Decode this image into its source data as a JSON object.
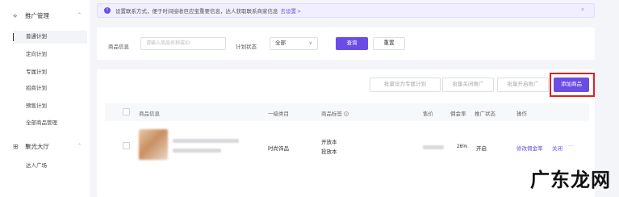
{
  "sidebar": {
    "group1": {
      "icon": "promo-icon",
      "label": "推广管理",
      "chevron": "⌃"
    },
    "items": [
      {
        "label": "普通计划",
        "active": true
      },
      {
        "label": "定向计划"
      },
      {
        "label": "专属计划"
      },
      {
        "label": "招商计划"
      },
      {
        "label": "预售计划"
      },
      {
        "label": "全部商品管理"
      }
    ],
    "group2": {
      "icon": "grid-icon",
      "label": "聚光大厅",
      "chevron": "⌃"
    },
    "items2": [
      {
        "label": "达人广场"
      }
    ]
  },
  "notice": {
    "icon": "info-icon",
    "text": "设置联系方式，便于时间接收巨应宝重要信息，达人获取联系商家信息",
    "link": "去设置 >",
    "close": "×"
  },
  "filter": {
    "product_label": "商品信息",
    "product_placeholder": "请输入商品名称或ID",
    "status_label": "计划状态",
    "status_value": "全部",
    "status_arrow": "∨",
    "query_button": "查询",
    "reset_button": "重置"
  },
  "toolbar": {
    "batch_exclusive": "批量设为专属计划",
    "batch_close": "批量关闭推广",
    "batch_open": "批量开启推广",
    "add_product": "添加商品"
  },
  "table": {
    "headers": {
      "product": "商品信息",
      "category": "一级类目",
      "tags": "商品标签",
      "price": "售价",
      "commission": "佣金率",
      "status": "推广状态",
      "actions": "操作"
    },
    "rows": [
      {
        "category": "时尚饰品",
        "tags": [
          "开放本",
          "投放本"
        ],
        "commission": "26%",
        "status": "开启",
        "action_edit": "修改佣金率",
        "action_close": "关闭",
        "action_more": "···"
      }
    ]
  },
  "watermark": "广东龙网",
  "colors": {
    "accent": "#6b4de6",
    "highlight": "#e02020"
  }
}
